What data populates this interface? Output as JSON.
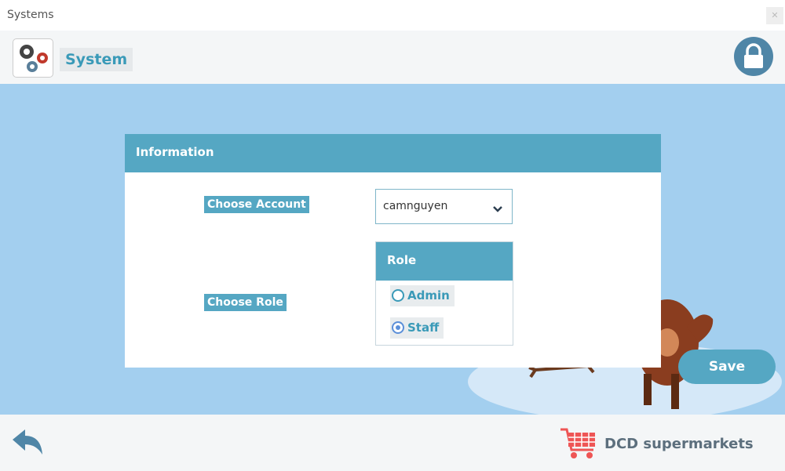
{
  "window": {
    "title": "Systems",
    "close_icon": "close-icon"
  },
  "header": {
    "title": "System",
    "app_icon": "gears-icon",
    "lock_icon": "lock-icon"
  },
  "info_card": {
    "title": "Information",
    "choose_account_label": "Choose Account",
    "account_value": "camnguyen",
    "choose_role_label": "Choose Role",
    "role_panel_title": "Role",
    "roles": [
      {
        "label": "Admin",
        "selected": false
      },
      {
        "label": "Staff",
        "selected": true
      }
    ]
  },
  "save_button": "Save",
  "footer": {
    "back_icon": "back-arrow-icon",
    "brand_icon": "shopping-cart-icon",
    "brand_name": "DCD supermarkets"
  },
  "colors": {
    "accent": "#55a7c3",
    "main_bg": "#a3cfef",
    "header_bg": "#f4f6f7",
    "lock_bg": "#4f86a7"
  }
}
